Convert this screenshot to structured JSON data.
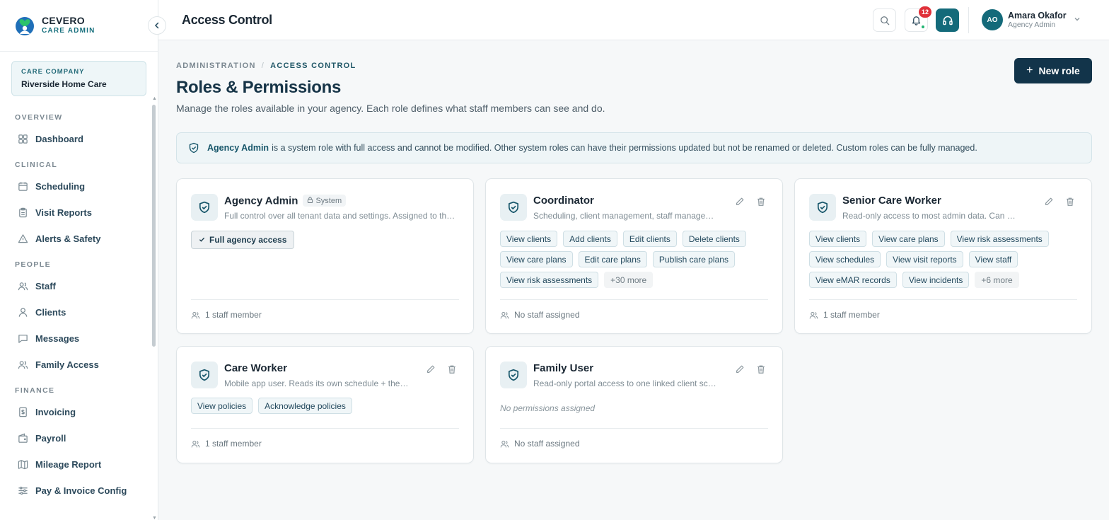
{
  "brand": {
    "name": "CEVERO",
    "sub": "CARE ADMIN"
  },
  "company": {
    "label": "CARE COMPANY",
    "name": "Riverside Home Care"
  },
  "nav": {
    "sections": [
      {
        "title": "OVERVIEW",
        "items": [
          {
            "label": "Dashboard",
            "icon": "grid-icon"
          }
        ]
      },
      {
        "title": "CLINICAL",
        "items": [
          {
            "label": "Scheduling",
            "icon": "calendar-icon"
          },
          {
            "label": "Visit Reports",
            "icon": "clipboard-icon"
          },
          {
            "label": "Alerts & Safety",
            "icon": "alert-triangle-icon"
          }
        ]
      },
      {
        "title": "PEOPLE",
        "items": [
          {
            "label": "Staff",
            "icon": "users-icon"
          },
          {
            "label": "Clients",
            "icon": "user-icon"
          },
          {
            "label": "Messages",
            "icon": "message-icon"
          },
          {
            "label": "Family Access",
            "icon": "users-icon"
          }
        ]
      },
      {
        "title": "FINANCE",
        "items": [
          {
            "label": "Invoicing",
            "icon": "invoice-icon"
          },
          {
            "label": "Payroll",
            "icon": "wallet-icon"
          },
          {
            "label": "Mileage Report",
            "icon": "map-icon"
          },
          {
            "label": "Pay & Invoice Config",
            "icon": "sliders-icon"
          }
        ]
      }
    ]
  },
  "topbar": {
    "title": "Access Control",
    "notifications": "12",
    "user": {
      "initials": "AO",
      "name": "Amara Okafor",
      "role": "Agency Admin"
    }
  },
  "page": {
    "breadcrumb": {
      "parent": "ADMINISTRATION",
      "current": "ACCESS CONTROL"
    },
    "title": "Roles & Permissions",
    "subtitle": "Manage the roles available in your agency. Each role defines what staff members can see and do.",
    "new_role": "New role",
    "banner": {
      "strong": "Agency Admin",
      "text": "is a system role with full access and cannot be modified. Other system roles can have their permissions updated but not be renamed or deleted. Custom roles can be fully managed."
    }
  },
  "roles": [
    {
      "name": "Agency Admin",
      "badge": "System",
      "desc": "Full control over all tenant data and settings. Assigned to the agency owner.",
      "full_access": "Full agency access",
      "staff": "1 staff member"
    },
    {
      "name": "Coordinator",
      "desc": "Scheduling, client management, staff management and reporting.",
      "tags": [
        "View clients",
        "Add clients",
        "Edit clients",
        "Delete clients",
        "View care plans",
        "Edit care plans",
        "Publish care plans",
        "View risk assessments"
      ],
      "more": "+30 more",
      "staff": "No staff assigned"
    },
    {
      "name": "Senior Care Worker",
      "desc": "Read-only access to most admin data. Can view reports and records.",
      "tags": [
        "View clients",
        "View care plans",
        "View risk assessments",
        "View schedules",
        "View visit reports",
        "View staff",
        "View eMAR records",
        "View incidents"
      ],
      "more": "+6 more",
      "staff": "1 staff member"
    },
    {
      "name": "Care Worker",
      "desc": "Mobile app user. Reads its own schedule + the assigned clients.",
      "tags": [
        "View policies",
        "Acknowledge policies"
      ],
      "staff": "1 staff member"
    },
    {
      "name": "Family User",
      "desc": "Read-only portal access to one linked client schedule.",
      "no_perm": "No permissions assigned",
      "staff": "No staff assigned"
    }
  ]
}
